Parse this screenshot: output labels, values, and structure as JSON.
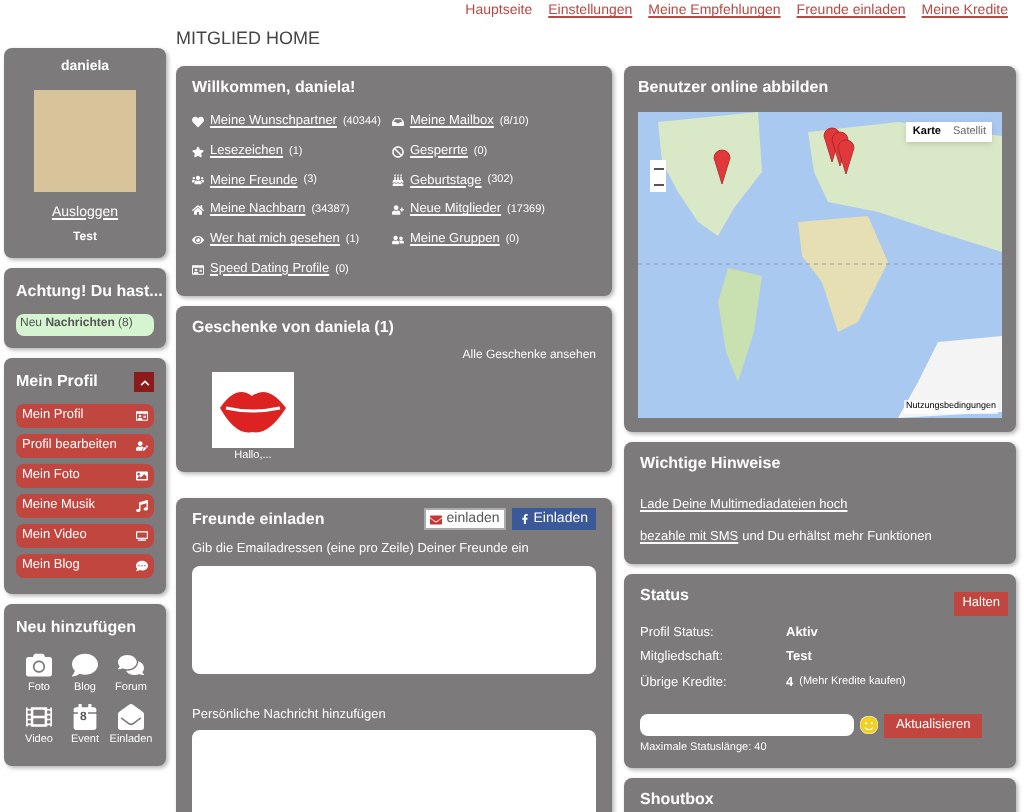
{
  "top_nav": [
    {
      "label": "Hauptseite",
      "selected": true
    },
    {
      "label": "Einstellungen",
      "selected": false
    },
    {
      "label": "Meine Empfehlungen",
      "selected": false
    },
    {
      "label": "Freunde einladen",
      "selected": false
    },
    {
      "label": "Meine Kredite",
      "selected": false
    }
  ],
  "page_title": "MITGLIED HOME",
  "user_card": {
    "name": "daniela",
    "logout": "Ausloggen",
    "membership": "Test"
  },
  "alert": {
    "title": "Achtung! Du hast...",
    "message": "Neu **Nachrichten** (8)"
  },
  "profile_menu": {
    "title": "Mein Profil",
    "expanded": true,
    "items": [
      {
        "label": "Mein Profil"
      },
      {
        "label": "Profil bearbeiten"
      },
      {
        "label": "Mein Foto"
      },
      {
        "label": "Meine Musik"
      },
      {
        "label": "Mein Video"
      },
      {
        "label": "Mein Blog"
      }
    ]
  },
  "add_new": {
    "title": "Neu hinzufügen",
    "items": [
      {
        "label": "Foto"
      },
      {
        "label": "Blog"
      },
      {
        "label": "Forum"
      },
      {
        "label": "Video"
      },
      {
        "label": "Event",
        "day": "8"
      },
      {
        "label": "Einladen"
      }
    ]
  },
  "welcome": {
    "title": "Willkommen, daniela!",
    "links": [
      {
        "label": "Meine Wunschpartner",
        "count": "(40344)"
      },
      {
        "label": "Meine Mailbox",
        "count": "(8/10)"
      },
      {
        "label": "Lesezeichen",
        "count": "(1)"
      },
      {
        "label": "Gesperrte",
        "count": "(0)"
      },
      {
        "label": "Meine Freunde",
        "count": "(3)"
      },
      {
        "label": "Geburtstage",
        "count": "(302)"
      },
      {
        "label": "Meine Nachbarn",
        "count": "(34387)"
      },
      {
        "label": "Neue Mitglieder",
        "count": "(17369)"
      },
      {
        "label": "Wer hat mich gesehen",
        "count": "(1)"
      },
      {
        "label": "Meine Gruppen",
        "count": "(0)"
      },
      {
        "label": "Speed Dating Profile",
        "count": "(0)"
      }
    ]
  },
  "gifts": {
    "title": "Geschenke von daniela (1)",
    "view_all": "Alle Geschenke ansehen",
    "items": [
      {
        "caption": "Hallo,..."
      }
    ]
  },
  "invite": {
    "title": "Freunde einladen",
    "buttons": [
      {
        "label": "einladen",
        "kind": "mail"
      },
      {
        "label": "Einladen",
        "kind": "facebook"
      }
    ],
    "email_label": "Gib die Emailadressen (eine pro Zeile) Deiner Freunde ein",
    "message_label": "Persönliche Nachricht hinzufügen"
  },
  "map": {
    "title": "Benutzer online abbilden",
    "map_types": [
      {
        "label": "Karte",
        "selected": true
      },
      {
        "label": "Satellit",
        "selected": false
      }
    ],
    "terms": "Nutzungsbedingungen"
  },
  "notices": {
    "title": "Wichtige Hinweise",
    "items": [
      {
        "link": "Lade Deine Multimediadateien hoch"
      },
      {
        "link": "bezahle mit SMS",
        "text": "und Du erhältst mehr Funktionen"
      }
    ]
  },
  "status": {
    "title": "Status",
    "pause_button": "Halten",
    "rows": [
      {
        "label": "Profil Status:",
        "value": "Aktiv"
      },
      {
        "label": "Mitgliedschaft:",
        "value": "Test"
      },
      {
        "label": "Übrige Kredite:",
        "value": "4",
        "note": "(Mehr Kredite kaufen)"
      }
    ],
    "update_button": "Aktualisieren",
    "hint": "Maximale Statuslänge: 40"
  },
  "shoutbox": {
    "title": "Shoutbox"
  }
}
